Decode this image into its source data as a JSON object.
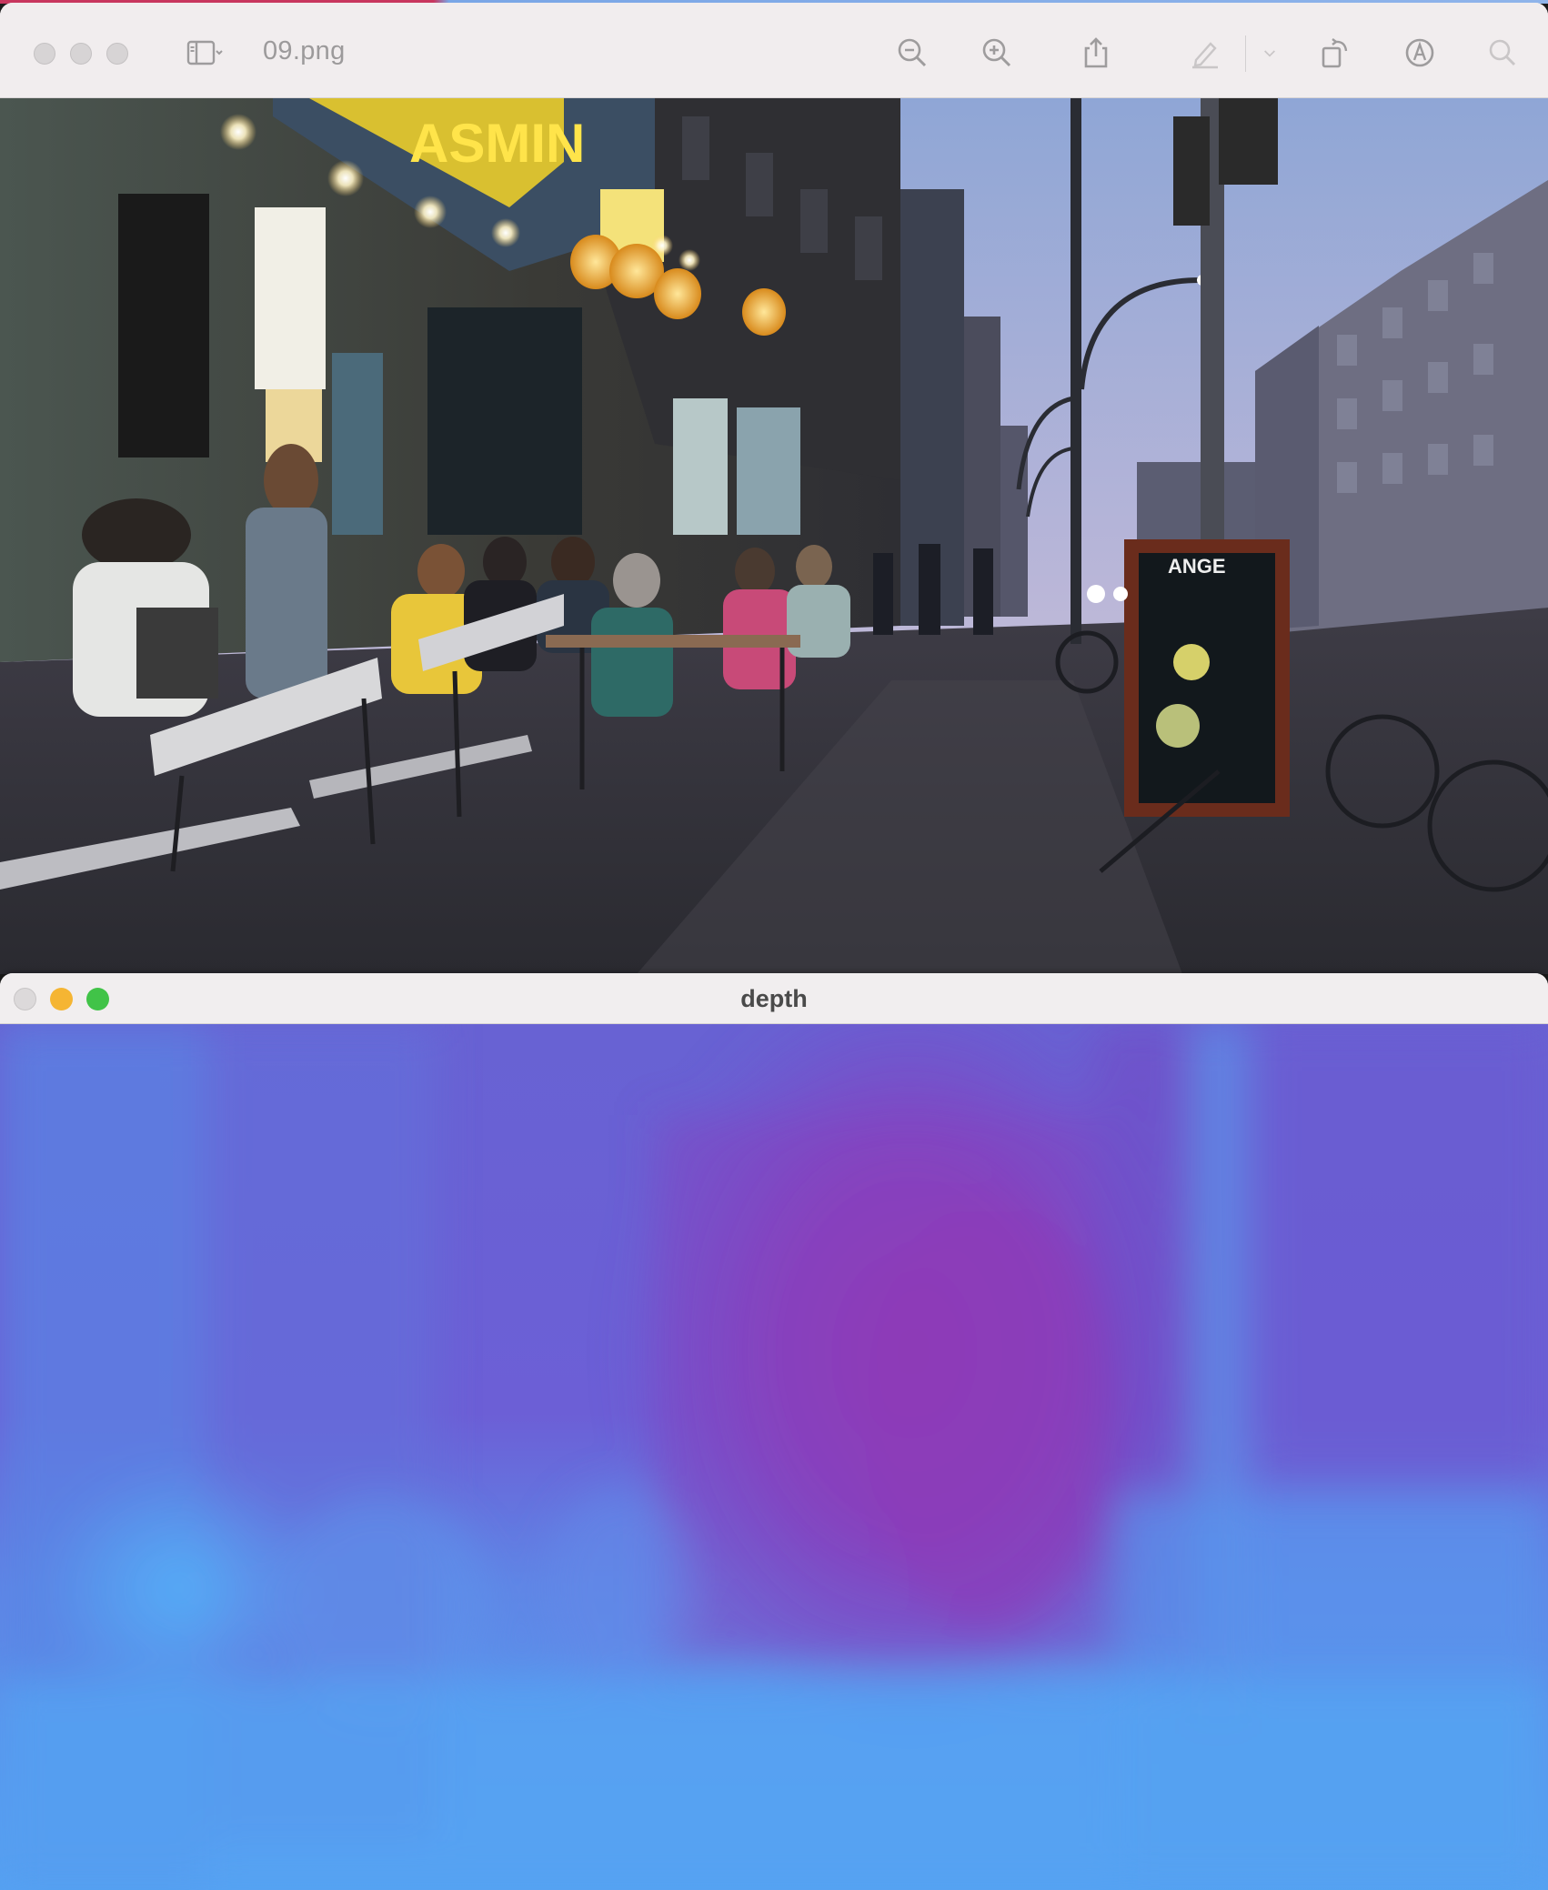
{
  "preview_window": {
    "title": "09.png",
    "toolbar": {
      "sidebar_toggle_icon": "sidebar-icon",
      "zoom_out_icon": "zoom-out-icon",
      "zoom_in_icon": "zoom-in-icon",
      "share_icon": "share-icon",
      "highlight_icon": "pen-icon",
      "rotate_icon": "rotate-icon",
      "markup_icon": "markup-icon",
      "search_icon": "search-icon"
    },
    "photo": {
      "shop_sign_text": "ASMIN",
      "board_sign_text": "ANGE"
    }
  },
  "depth_window": {
    "title": "depth",
    "colors": {
      "near": "#56a8f4",
      "mid": "#6a62d6",
      "far": "#9b33ad"
    }
  }
}
